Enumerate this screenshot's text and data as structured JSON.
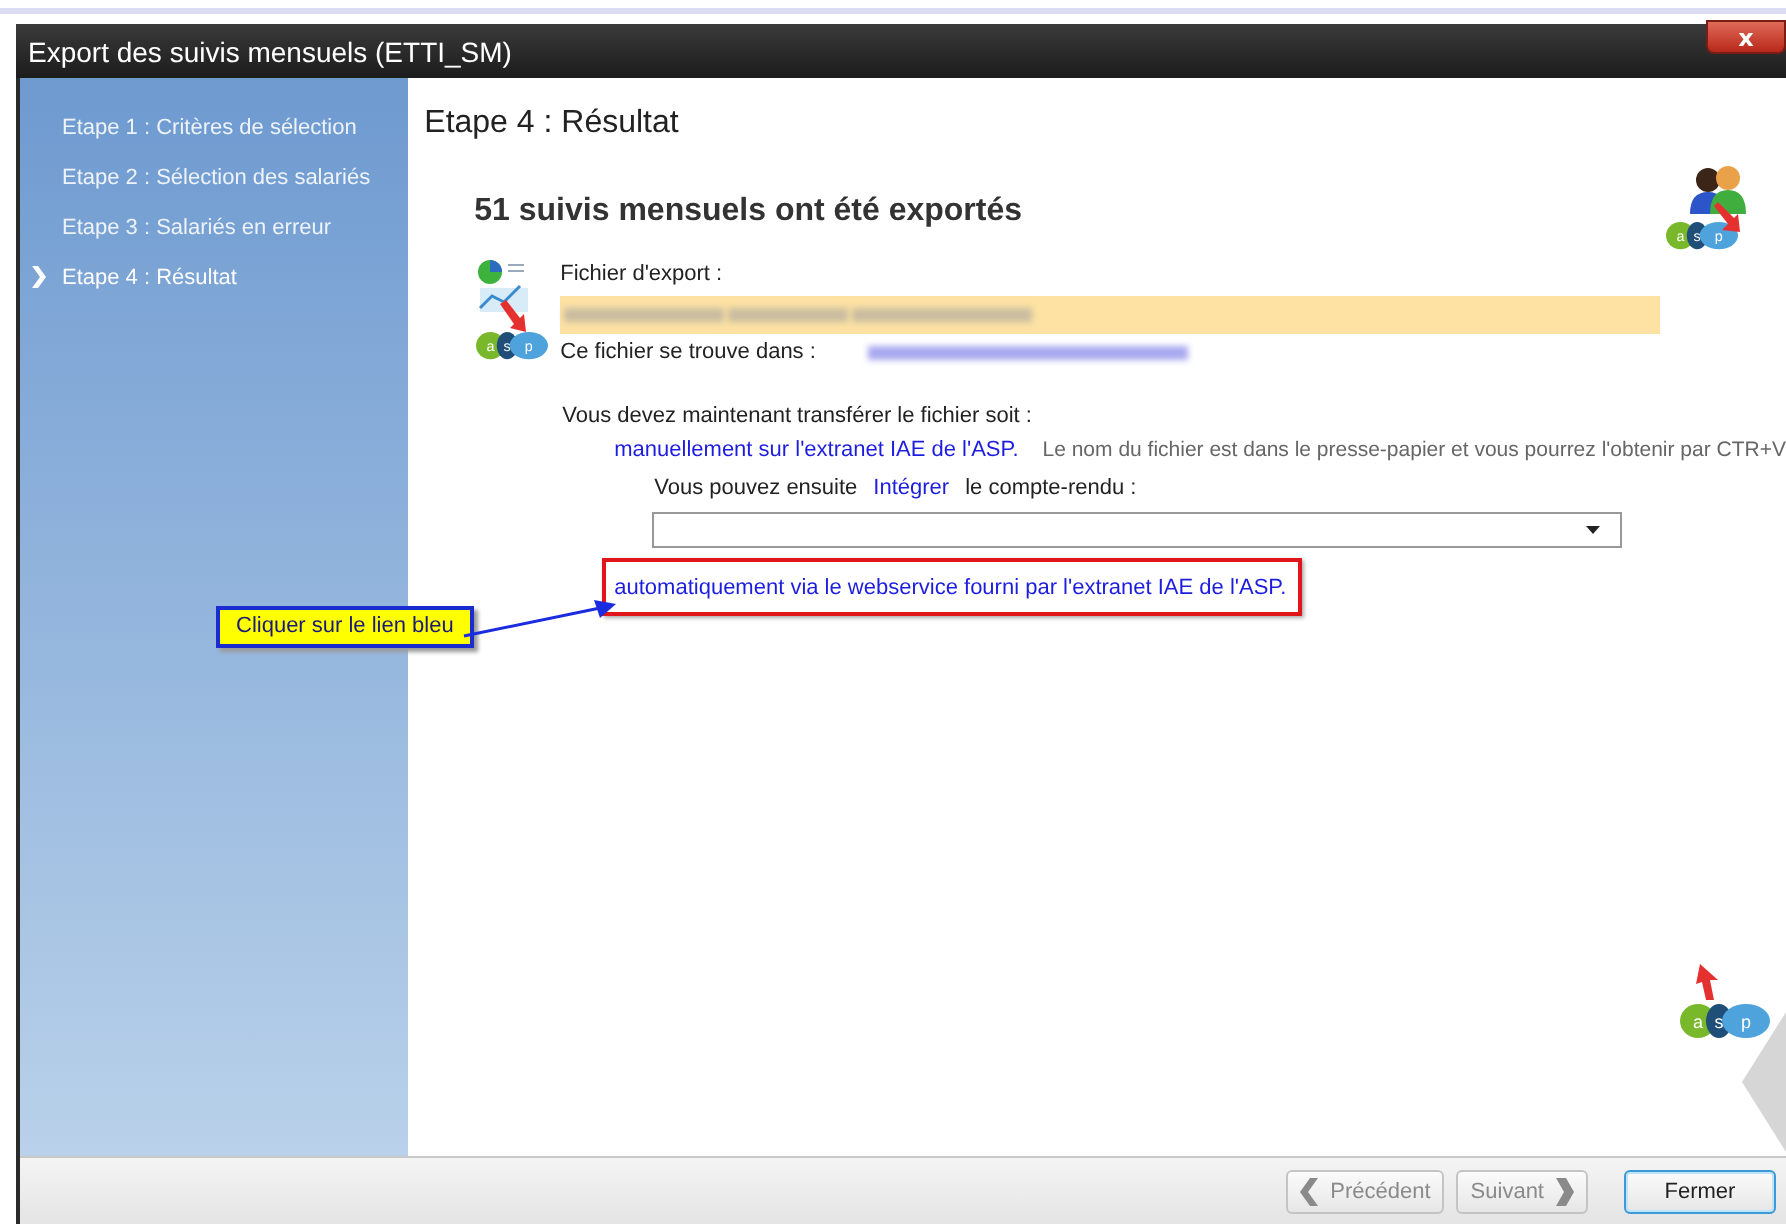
{
  "window": {
    "title": "Export des suivis mensuels (ETTI_SM)",
    "close": "x"
  },
  "steps": [
    {
      "label": "Etape 1 : Critères de sélection",
      "selected": false
    },
    {
      "label": "Etape 2 : Sélection des salariés",
      "selected": false
    },
    {
      "label": "Etape 3 : Salariés en erreur",
      "selected": false
    },
    {
      "label": "Etape 4 : Résultat",
      "selected": true
    }
  ],
  "page_title": "Etape 4 : Résultat",
  "heading": "51 suivis mensuels ont été exportés",
  "export_file_label": "Fichier d'export :",
  "location_label": "Ce fichier se trouve dans  :",
  "transfer_text": "Vous devez maintenant transférer le fichier soit :",
  "manual_link": "manuellement sur l'extranet IAE de l'ASP.",
  "clipboard_note": "Le nom du fichier est dans le presse-papier et vous pourrez l'obtenir par CTR+V",
  "then_text": "Vous pouvez ensuite",
  "integrate_link": "Intégrer",
  "report_text": "le compte-rendu :",
  "auto_link": "automatiquement via le webservice fourni par l'extranet IAE de l'ASP.",
  "callout": "Cliquer sur le lien bleu",
  "logos": [
    {
      "letters": [
        "a",
        "s",
        "p"
      ]
    },
    {
      "letters": [
        "a",
        "s",
        "p"
      ]
    },
    {
      "letters": [
        "a",
        "s",
        "p"
      ]
    }
  ],
  "buttons": [
    {
      "label": "Précédent",
      "kind": "back",
      "disabled": true
    },
    {
      "label": "Suivant",
      "kind": "next",
      "disabled": true
    },
    {
      "label": "Fermer",
      "kind": "plain",
      "disabled": false
    }
  ]
}
